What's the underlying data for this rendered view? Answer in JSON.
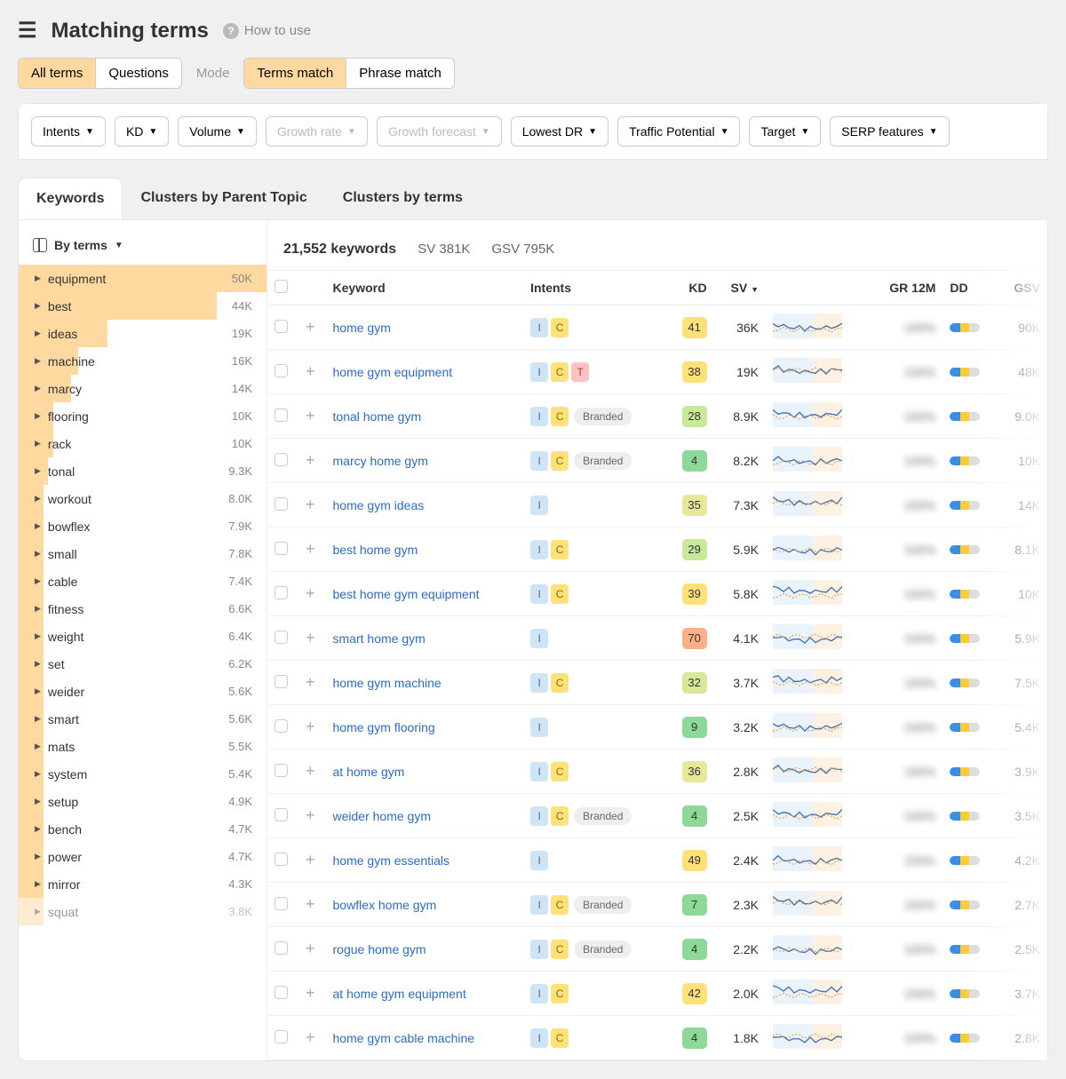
{
  "header": {
    "title": "Matching terms",
    "how_to_use": "How to use"
  },
  "seg1": {
    "all_terms": "All terms",
    "questions": "Questions"
  },
  "mode_label": "Mode",
  "seg2": {
    "terms_match": "Terms match",
    "phrase_match": "Phrase match"
  },
  "filters": [
    {
      "label": "Intents",
      "disabled": false
    },
    {
      "label": "KD",
      "disabled": false
    },
    {
      "label": "Volume",
      "disabled": false
    },
    {
      "label": "Growth rate",
      "disabled": true
    },
    {
      "label": "Growth forecast",
      "disabled": true
    },
    {
      "label": "Lowest DR",
      "disabled": false
    },
    {
      "label": "Traffic Potential",
      "disabled": false
    },
    {
      "label": "Target",
      "disabled": false
    },
    {
      "label": "SERP features",
      "disabled": false
    }
  ],
  "tabs2": [
    {
      "label": "Keywords",
      "active": true
    },
    {
      "label": "Clusters by Parent Topic",
      "active": false
    },
    {
      "label": "Clusters by terms",
      "active": false
    }
  ],
  "by_terms_label": "By terms",
  "terms": [
    {
      "label": "equipment",
      "count": "50K",
      "bar": 100
    },
    {
      "label": "best",
      "count": "44K",
      "bar": 80
    },
    {
      "label": "ideas",
      "count": "19K",
      "bar": 36
    },
    {
      "label": "machine",
      "count": "16K",
      "bar": 24
    },
    {
      "label": "marcy",
      "count": "14K",
      "bar": 21
    },
    {
      "label": "flooring",
      "count": "10K",
      "bar": 14
    },
    {
      "label": "rack",
      "count": "10K",
      "bar": 14
    },
    {
      "label": "tonal",
      "count": "9.3K",
      "bar": 12
    },
    {
      "label": "workout",
      "count": "8.0K",
      "bar": 10
    },
    {
      "label": "bowflex",
      "count": "7.9K",
      "bar": 10
    },
    {
      "label": "small",
      "count": "7.8K",
      "bar": 10
    },
    {
      "label": "cable",
      "count": "7.4K",
      "bar": 10
    },
    {
      "label": "fitness",
      "count": "6.6K",
      "bar": 10
    },
    {
      "label": "weight",
      "count": "6.4K",
      "bar": 10
    },
    {
      "label": "set",
      "count": "6.2K",
      "bar": 10
    },
    {
      "label": "weider",
      "count": "5.6K",
      "bar": 10
    },
    {
      "label": "smart",
      "count": "5.6K",
      "bar": 10
    },
    {
      "label": "mats",
      "count": "5.5K",
      "bar": 10
    },
    {
      "label": "system",
      "count": "5.4K",
      "bar": 10
    },
    {
      "label": "setup",
      "count": "4.9K",
      "bar": 10
    },
    {
      "label": "bench",
      "count": "4.7K",
      "bar": 10
    },
    {
      "label": "power",
      "count": "4.7K",
      "bar": 10
    },
    {
      "label": "mirror",
      "count": "4.3K",
      "bar": 10
    },
    {
      "label": "squat",
      "count": "3.8K",
      "bar": 10,
      "faded": true
    }
  ],
  "stats": {
    "count": "21,552 keywords",
    "sv": "SV 381K",
    "gsv": "GSV 795K"
  },
  "columns": {
    "keyword": "Keyword",
    "intents": "Intents",
    "kd": "KD",
    "sv": "SV",
    "gr12m": "GR 12M",
    "dd": "DD",
    "gsv": "GSV"
  },
  "rows": [
    {
      "kw": "home gym",
      "intents": [
        "I",
        "C"
      ],
      "branded": false,
      "kd": "41",
      "kd_color": "#ffe17a",
      "sv": "36K",
      "gsv": "90K"
    },
    {
      "kw": "home gym equipment",
      "intents": [
        "I",
        "C",
        "T"
      ],
      "branded": false,
      "kd": "38",
      "kd_color": "#ffe17a",
      "sv": "19K",
      "gsv": "48K"
    },
    {
      "kw": "tonal home gym",
      "intents": [
        "I",
        "C"
      ],
      "branded": true,
      "kd": "28",
      "kd_color": "#c8e89a",
      "sv": "8.9K",
      "gsv": "9.0K"
    },
    {
      "kw": "marcy home gym",
      "intents": [
        "I",
        "C"
      ],
      "branded": true,
      "kd": "4",
      "kd_color": "#8ed99a",
      "sv": "8.2K",
      "gsv": "10K"
    },
    {
      "kw": "home gym ideas",
      "intents": [
        "I"
      ],
      "branded": false,
      "kd": "35",
      "kd_color": "#e8e89a",
      "sv": "7.3K",
      "gsv": "14K"
    },
    {
      "kw": "best home gym",
      "intents": [
        "I",
        "C"
      ],
      "branded": false,
      "kd": "29",
      "kd_color": "#c8e89a",
      "sv": "5.9K",
      "gsv": "8.1K"
    },
    {
      "kw": "best home gym equipment",
      "intents": [
        "I",
        "C"
      ],
      "branded": false,
      "kd": "39",
      "kd_color": "#ffe17a",
      "sv": "5.8K",
      "gsv": "10K"
    },
    {
      "kw": "smart home gym",
      "intents": [
        "I"
      ],
      "branded": false,
      "kd": "70",
      "kd_color": "#ffb088",
      "sv": "4.1K",
      "gsv": "5.9K"
    },
    {
      "kw": "home gym machine",
      "intents": [
        "I",
        "C"
      ],
      "branded": false,
      "kd": "32",
      "kd_color": "#d8e89a",
      "sv": "3.7K",
      "gsv": "7.5K"
    },
    {
      "kw": "home gym flooring",
      "intents": [
        "I"
      ],
      "branded": false,
      "kd": "9",
      "kd_color": "#8ed99a",
      "sv": "3.2K",
      "gsv": "5.4K"
    },
    {
      "kw": "at home gym",
      "intents": [
        "I",
        "C"
      ],
      "branded": false,
      "kd": "36",
      "kd_color": "#e8e89a",
      "sv": "2.8K",
      "gsv": "3.9K"
    },
    {
      "kw": "weider home gym",
      "intents": [
        "I",
        "C"
      ],
      "branded": true,
      "kd": "4",
      "kd_color": "#8ed99a",
      "sv": "2.5K",
      "gsv": "3.5K"
    },
    {
      "kw": "home gym essentials",
      "intents": [
        "I"
      ],
      "branded": false,
      "kd": "49",
      "kd_color": "#ffe17a",
      "sv": "2.4K",
      "gsv": "4.2K"
    },
    {
      "kw": "bowflex home gym",
      "intents": [
        "I",
        "C"
      ],
      "branded": true,
      "kd": "7",
      "kd_color": "#8ed99a",
      "sv": "2.3K",
      "gsv": "2.7K"
    },
    {
      "kw": "rogue home gym",
      "intents": [
        "I",
        "C"
      ],
      "branded": true,
      "kd": "4",
      "kd_color": "#8ed99a",
      "sv": "2.2K",
      "gsv": "2.5K"
    },
    {
      "kw": "at home gym equipment",
      "intents": [
        "I",
        "C"
      ],
      "branded": false,
      "kd": "42",
      "kd_color": "#ffe17a",
      "sv": "2.0K",
      "gsv": "3.7K"
    },
    {
      "kw": "home gym cable machine",
      "intents": [
        "I",
        "C"
      ],
      "branded": false,
      "kd": "4",
      "kd_color": "#8ed99a",
      "sv": "1.8K",
      "gsv": "2.8K"
    }
  ],
  "branded_label": "Branded",
  "blur_placeholder": "100%"
}
